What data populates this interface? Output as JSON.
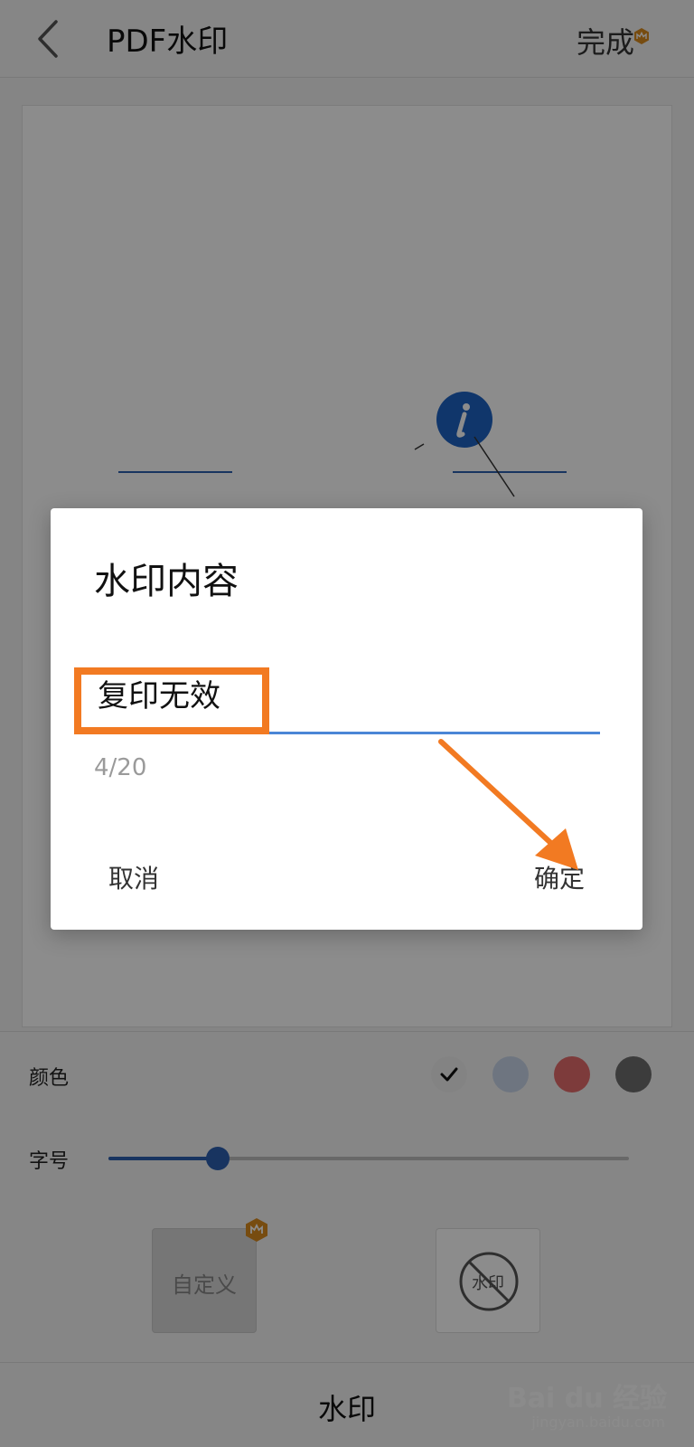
{
  "header": {
    "title": "PDF水印",
    "done_label": "完成"
  },
  "controls": {
    "color_label": "颜色",
    "size_label": "字号",
    "colors": [
      "#eeeeee",
      "#c9d6ea",
      "#e46c6c",
      "#6d6d6d"
    ],
    "selected_color_index": 0,
    "font_size_level": 0.21,
    "watermark_options": [
      "自定义",
      "水印"
    ]
  },
  "bottom": {
    "title": "水印",
    "brand": "Bai du 经验",
    "brand_sub": "jingyan.baidu.com"
  },
  "dialog": {
    "title": "水印内容",
    "input_value": "复印无效",
    "char_count": "4/20",
    "cancel_label": "取消",
    "ok_label": "确定"
  },
  "accent_colors": {
    "primary": "#2d5fb0",
    "annotation": "#f27a22",
    "crown": "#d98a1e"
  }
}
